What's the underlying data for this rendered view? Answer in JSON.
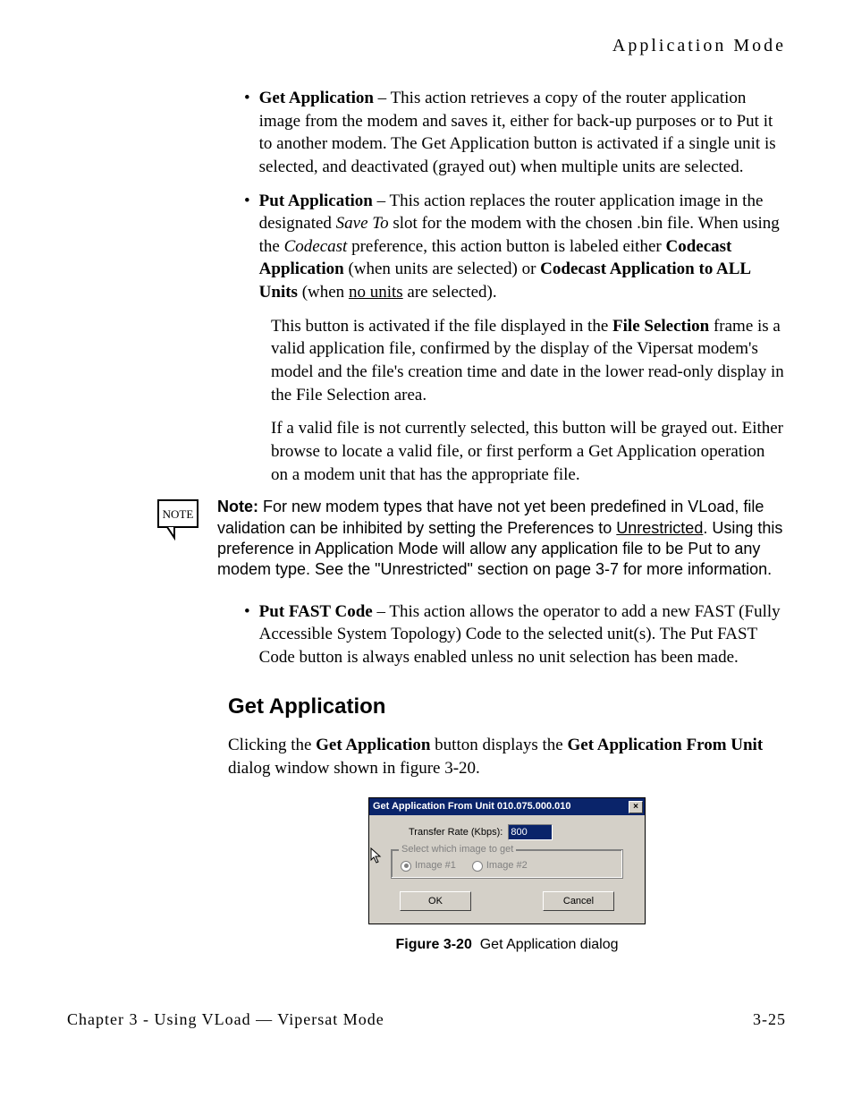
{
  "header": {
    "title": "Application Mode"
  },
  "bullets": {
    "b1": {
      "term": "Get Application",
      "rest": " – This action retrieves a copy of the router application image from the modem and saves it, either for back-up purposes or to Put it to another modem. The Get Application button is activated if a single unit is selected, and deactivated (grayed out) when multiple units are selected."
    },
    "b2": {
      "term": "Put Application",
      "seg1": " – This action replaces the router application image in the designated ",
      "saveTo": "Save To",
      "seg2": " slot for the modem with the chosen .bin file. When using the ",
      "codecast": "Codecast",
      "seg3": " preference, this action button is labeled either ",
      "ca": "Codecast Application",
      "seg4": " (when units are selected) or ",
      "caAll": "Codecast Application to ALL Units",
      "seg5": " (when ",
      "noUnits": "no units",
      "seg6": " are selected)."
    },
    "cont1": {
      "pre": "This button is activated if the file displayed in the ",
      "fs": "File Selection",
      "post": " frame is a valid application file, confirmed by the display of the Vipersat modem's model and the file's creation time and date in the lower read-only display in the File Selection area."
    },
    "cont2": "If a valid file is not currently selected, this button will be grayed out. Either browse to locate a valid file, or first perform a Get Application operation on a modem unit that has the appropriate file.",
    "b3": {
      "term": "Put FAST Code",
      "rest": " – This action allows the operator to add a new FAST (Fully Accessible System Topology) Code to the selected unit(s). The Put FAST Code button is always enabled unless no unit selection has been made."
    }
  },
  "note": {
    "label": "Note:",
    "pre": "For new modem types that have not yet been predefined in VLoad, file validation can be inhibited by setting the Preferences to ",
    "unrestricted": "Unrestricted",
    "post": ". Using this preference in Application Mode will allow any application file to be Put to any modem type. See the \"Unrestricted\" section on page 3-7 for more information.",
    "iconText": "NOTE"
  },
  "section": {
    "heading": "Get Application"
  },
  "intro": {
    "pre": "Clicking the ",
    "ga": "Get Application",
    "mid": " button displays the ",
    "gafu": "Get Application From Unit",
    "post": " dialog window shown in figure 3-20."
  },
  "dialog": {
    "title": "Get Application From Unit 010.075.000.010",
    "close": "×",
    "rateLabel": "Transfer Rate (Kbps):",
    "rateValue": "800",
    "groupLegend": "Select which image to get",
    "opt1": "Image #1",
    "opt2": "Image #2",
    "ok": "OK",
    "cancel": "Cancel"
  },
  "figure": {
    "num": "Figure 3-20",
    "caption": "Get Application dialog"
  },
  "footer": {
    "left": "Chapter 3 - Using VLoad — Vipersat Mode",
    "right": "3-25"
  }
}
